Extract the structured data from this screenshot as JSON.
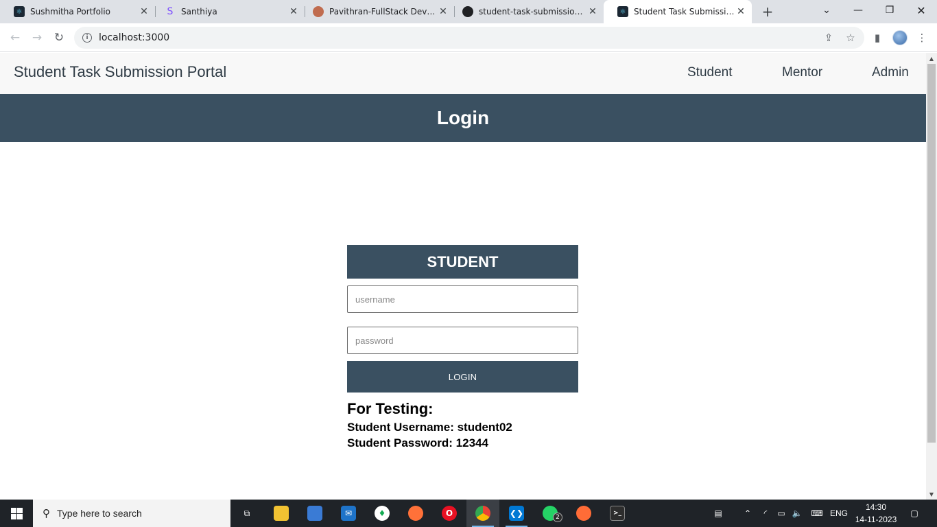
{
  "browser": {
    "tabs": [
      {
        "title": "Sushmitha Portfolio",
        "favicon": "react-icon",
        "active": false
      },
      {
        "title": "Santhiya",
        "favicon": "s-logo-icon",
        "active": false
      },
      {
        "title": "Pavithran-FullStack Develope",
        "favicon": "avatar-icon",
        "active": false
      },
      {
        "title": "student-task-submission-fro",
        "favicon": "github-icon",
        "active": false
      },
      {
        "title": "Student Task Submission Po",
        "favicon": "react-icon",
        "active": true
      }
    ],
    "new_tab": "+",
    "address": "localhost:3000"
  },
  "page": {
    "brand": "Student Task Submission Portal",
    "nav": {
      "student": "Student",
      "mentor": "Mentor",
      "admin": "Admin"
    },
    "banner_title": "Login",
    "card_title": "STUDENT",
    "username_placeholder": "username",
    "password_placeholder": "password",
    "login_label": "LOGIN",
    "testing_title": "For Testing:",
    "testing_username": "Student Username: student02",
    "testing_password": "Student Password: 12344"
  },
  "taskbar": {
    "search_placeholder": "Type here to search",
    "whatsapp_badge": "2",
    "language": "ENG",
    "time": "14:30",
    "date": "14-11-2023"
  },
  "colors": {
    "primary": "#3a5061",
    "navbar_bg": "#f8f8f8",
    "taskbar_bg": "#1f2328"
  }
}
